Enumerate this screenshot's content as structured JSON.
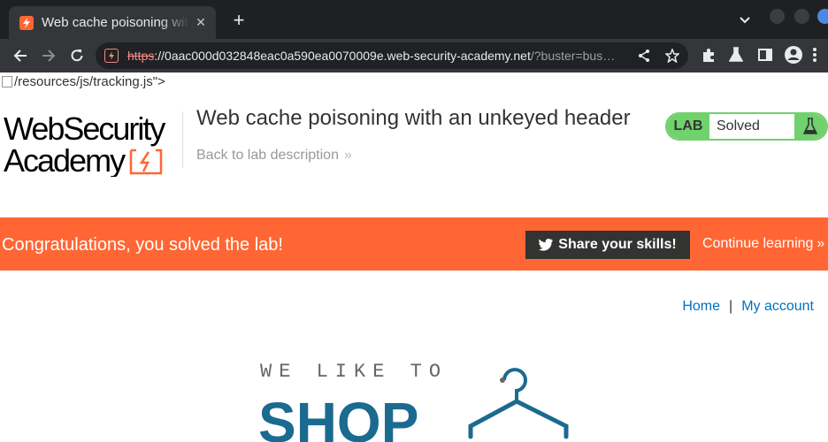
{
  "browser": {
    "tab_title": "Web cache poisoning with an unkeyed header",
    "tab_close": "✕",
    "new_tab": "+",
    "url_scheme": "https",
    "url_host": "://0aac000d032848eac0a590ea0070009e.web-security-academy.net",
    "url_path": "/?buster=bus…"
  },
  "page": {
    "broken_image_alt": "/resources/js/tracking.js\">",
    "lab_title": "Web cache poisoning with an unkeyed header",
    "back_link": "Back to lab description",
    "chevrons": "»",
    "status_label": "LAB",
    "status_value": "Solved",
    "logo_line1": "WebSecurity",
    "logo_line2": "Academy"
  },
  "banner": {
    "message": "Congratulations, you solved the lab!",
    "share_label": "Share your skills!",
    "continue_label": "Continue learning",
    "chevrons": "»"
  },
  "nav": {
    "home": "Home",
    "separator": "|",
    "my_account": "My account"
  },
  "shop": {
    "line1": "WE LIKE TO",
    "line2": "SHOP"
  },
  "colors": {
    "accent": "#ff6633",
    "solved_green": "#70d16d",
    "link_blue": "#0071bc",
    "shop_blue": "#1b6a8f"
  }
}
